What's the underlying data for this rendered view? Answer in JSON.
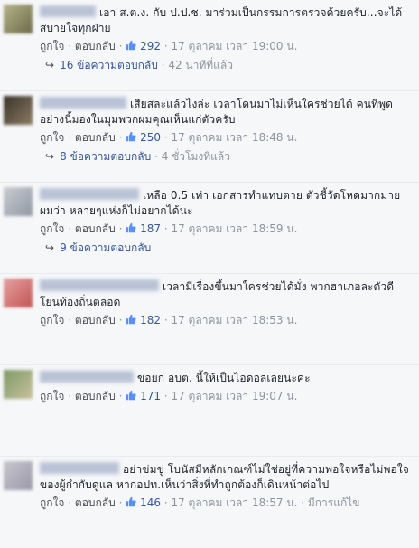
{
  "ui": {
    "like": "ถูกใจ",
    "reply": "ตอบกลับ",
    "at_label": "เวลา",
    "sep": "·",
    "reply_arrow": "↪",
    "like_icon": "thumbs-up-icon",
    "colors": {
      "link": "#365899",
      "meta": "#8d949e",
      "background": "#f6f7f9"
    }
  },
  "comments": [
    {
      "text": "เอา ส.ต.ง. กับ ป.ป.ช. มาร่วมเป็นกรรมการตรวจด้วยครับ...จะได้สบายใจทุกฝ่าย",
      "likes": "292",
      "date": "17 ตุลาคม",
      "time": "19:00 น.",
      "edited": "",
      "replies": "16 ข้อความตอบกลับ",
      "reply_age": "42 นาทีที่แล้ว"
    },
    {
      "text": "เสียสละแล้วไงล่ะ เวลาโดนมาไม่เห็นใครช่วยได้ คนที่พูดอย่างนี้มองในมุมพวกผมคุณเห็นแก่ตัวครับ",
      "likes": "250",
      "date": "17 ตุลาคม",
      "time": "18:48 น.",
      "edited": "",
      "replies": "8 ข้อความตอบกลับ",
      "reply_age": "4 ชั่วโมงที่แล้ว"
    },
    {
      "text": "เหลือ 0.5 เท่า เอกสารทำแทบตาย ตัวชี้วัดโหดมากมาย ผมว่า หลายๆแห่งก็ไม่อยากได้นะ",
      "likes": "187",
      "date": "17 ตุลาคม",
      "time": "18:59 น.",
      "edited": "",
      "replies": "9 ข้อความตอบกลับ",
      "reply_age": ""
    },
    {
      "text": "เวลามีเรื่องขึ้นมาใครช่วยได้มั่ง พวกฮาเภอละตัวดี โยนท้องถิ่นตลอด",
      "likes": "182",
      "date": "17 ตุลาคม",
      "time": "18:53 น.",
      "edited": "",
      "replies": "",
      "reply_age": ""
    },
    {
      "text": "ขอยก อบต. นี้ให้เป็นไอดอลเลยนะคะ",
      "likes": "171",
      "date": "17 ตุลาคม",
      "time": "19:07 น.",
      "edited": "",
      "replies": "",
      "reply_age": ""
    },
    {
      "text": "อย่าข่มขู่ โบนัสมีหลักเกณฑ์ไม่ใช่อยู่ที่ความพอใจหรือไม่พอใจของผู้กำกับดูแล หากอปท.เห็นว่าสิ่งที่ทำถูกต้องก็เดินหน้าต่อไป",
      "likes": "146",
      "date": "17 ตุลาคม",
      "time": "18:57 น.",
      "edited": "มีการแก้ไข",
      "replies": "",
      "reply_age": ""
    }
  ]
}
